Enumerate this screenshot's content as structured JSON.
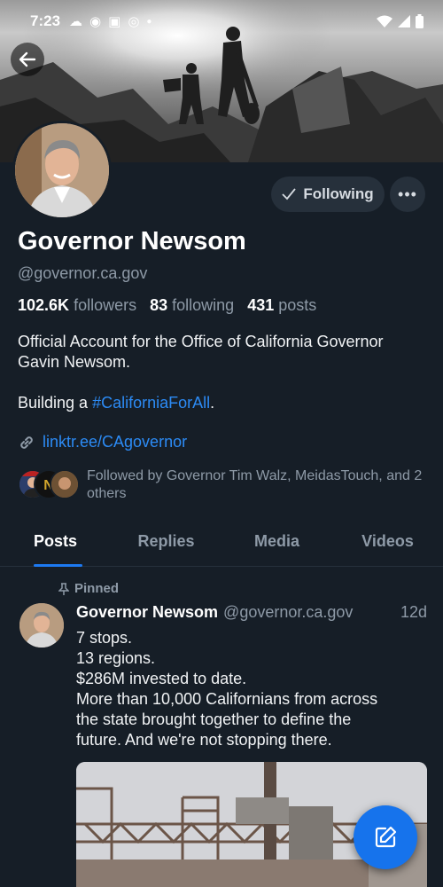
{
  "status_bar": {
    "time": "7:23"
  },
  "profile": {
    "display_name": "Governor Newsom",
    "handle": "@governor.ca.gov",
    "followers_count": "102.6K",
    "followers_label": "followers",
    "following_count": "83",
    "following_label": "following",
    "posts_count": "431",
    "posts_label": "posts",
    "bio_line1": "Official Account for the Office of California Governor Gavin Newsom.",
    "bio_line2_prefix": "Building a ",
    "bio_hashtag": "#CaliforniaForAll",
    "bio_line2_suffix": ".",
    "link": "linktr.ee/CAgovernor",
    "followed_by": "Followed by Governor Tim Walz, MeidasTouch, and 2 others",
    "follow_button_label": "Following"
  },
  "tabs": [
    {
      "label": "Posts",
      "active": true
    },
    {
      "label": "Replies",
      "active": false
    },
    {
      "label": "Media",
      "active": false
    },
    {
      "label": "Videos",
      "active": false
    }
  ],
  "pinned_post": {
    "pinned_label": "Pinned",
    "author": "Governor Newsom",
    "handle": "@governor.ca.gov",
    "time": "12d",
    "lines": [
      "7 stops.",
      "13 regions.",
      "$286M invested to date.",
      "More than 10,000 Californians from across",
      "the state brought together to define the",
      "future. And we're not stopping there."
    ]
  },
  "colors": {
    "background": "#161e27",
    "accent_blue": "#1673ec",
    "link_blue": "#2c8bf5",
    "muted_text": "#8e9aa7"
  },
  "icons": {
    "back": "arrow-left-icon",
    "following_check": "check-icon",
    "more": "ellipsis-icon",
    "link": "link-icon",
    "pin": "pin-icon",
    "compose": "compose-icon"
  }
}
